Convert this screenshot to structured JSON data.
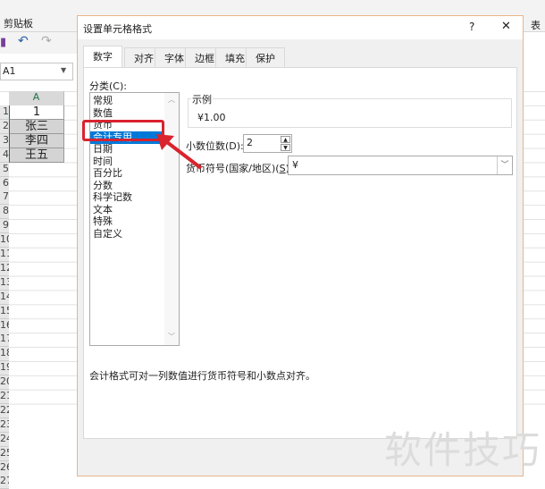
{
  "ribbon": {
    "clipboard_label": "剪贴板",
    "right_label": "表"
  },
  "namebox": {
    "value": "A1"
  },
  "sheet": {
    "column": "A",
    "rows": [
      "1",
      "2",
      "3",
      "4",
      "5",
      "6",
      "7",
      "8",
      "9",
      "10",
      "11",
      "12",
      "13",
      "14",
      "15",
      "16",
      "17",
      "18",
      "19",
      "20",
      "21",
      "22",
      "23",
      "24",
      "25",
      "26",
      "27"
    ],
    "cells": [
      "1",
      "张三",
      "李四",
      "王五"
    ]
  },
  "dialog": {
    "title": "设置单元格格式",
    "help": "?",
    "close": "✕",
    "tabs": [
      "数字",
      "对齐",
      "字体",
      "边框",
      "填充",
      "保护"
    ],
    "category_label": "分类(C):",
    "categories": [
      "常规",
      "数值",
      "货币",
      "会计专用",
      "日期",
      "时间",
      "百分比",
      "分数",
      "科学记数",
      "文本",
      "特殊",
      "自定义"
    ],
    "selected_category": "会计专用",
    "sample_label": "示例",
    "sample_value": "¥1.00",
    "decimal_label": "小数位数(D):",
    "decimal_value": "2",
    "currency_label": "货币符号(国家/地区)(S):",
    "currency_value": "¥",
    "description": "会计格式可对一列数值进行货币符号和小数点对齐。"
  },
  "highlight_color": "#d9232e",
  "watermark": "软件技巧"
}
